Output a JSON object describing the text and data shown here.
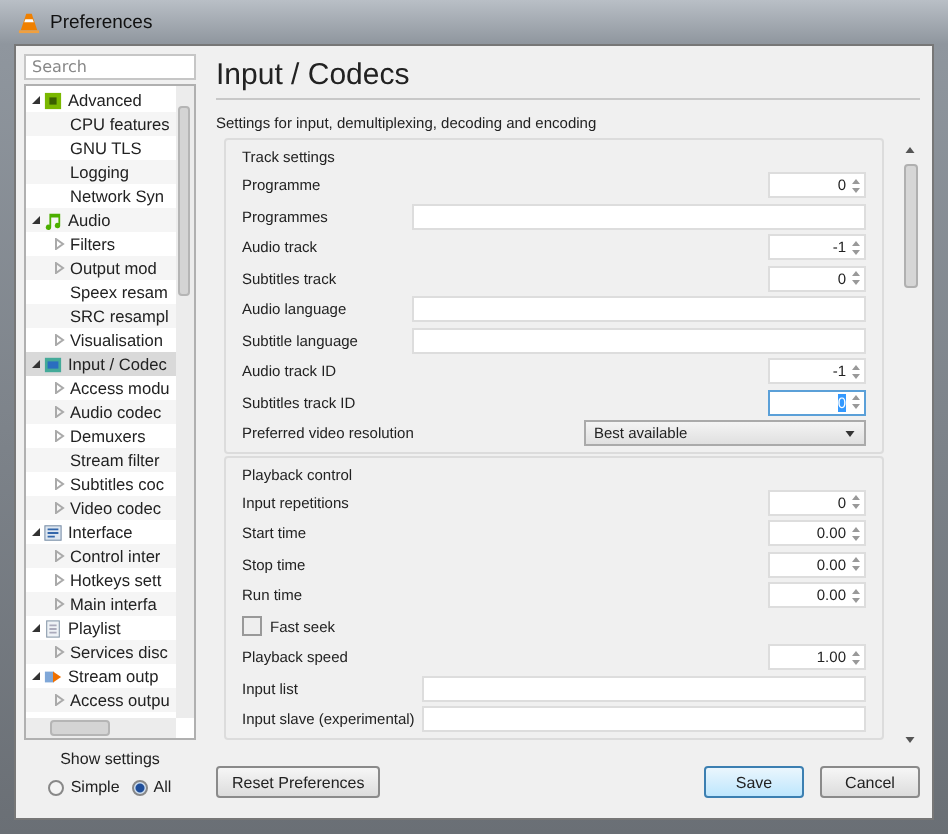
{
  "window": {
    "title": "Preferences"
  },
  "search": {
    "placeholder": "Search"
  },
  "tree": [
    {
      "label": "Advanced",
      "expanded": true,
      "selected": false,
      "children": [
        {
          "label": "CPU features",
          "expandable": false,
          "selected": false
        },
        {
          "label": "GNU TLS",
          "expandable": false,
          "selected": false
        },
        {
          "label": "Logging",
          "expandable": false,
          "selected": false
        },
        {
          "label": "Network Syn",
          "expandable": false,
          "selected": false
        }
      ]
    },
    {
      "label": "Audio",
      "expanded": true,
      "selected": false,
      "children": [
        {
          "label": "Filters",
          "expandable": true,
          "selected": false
        },
        {
          "label": "Output mod",
          "expandable": true,
          "selected": false
        },
        {
          "label": "Speex resam",
          "expandable": false,
          "selected": false
        },
        {
          "label": "SRC resampl",
          "expandable": false,
          "selected": false
        },
        {
          "label": "Visualisation",
          "expandable": true,
          "selected": false
        }
      ]
    },
    {
      "label": "Input / Codec",
      "expanded": true,
      "selected": true,
      "children": [
        {
          "label": "Access modu",
          "expandable": true,
          "selected": false
        },
        {
          "label": "Audio codec",
          "expandable": true,
          "selected": false
        },
        {
          "label": "Demuxers",
          "expandable": true,
          "selected": false
        },
        {
          "label": "Stream filter",
          "expandable": false,
          "selected": false
        },
        {
          "label": "Subtitles coc",
          "expandable": true,
          "selected": false
        },
        {
          "label": "Video codec",
          "expandable": true,
          "selected": false
        }
      ]
    },
    {
      "label": "Interface",
      "expanded": true,
      "selected": false,
      "children": [
        {
          "label": "Control inter",
          "expandable": true,
          "selected": false
        },
        {
          "label": "Hotkeys sett",
          "expandable": true,
          "selected": false
        },
        {
          "label": "Main interfa",
          "expandable": true,
          "selected": false
        }
      ]
    },
    {
      "label": "Playlist",
      "expanded": true,
      "selected": false,
      "children": [
        {
          "label": "Services disc",
          "expandable": true,
          "selected": false
        }
      ]
    },
    {
      "label": "Stream outp",
      "expanded": true,
      "selected": false,
      "children": [
        {
          "label": "Access outpu",
          "expandable": true,
          "selected": false
        }
      ]
    }
  ],
  "show_settings": {
    "label": "Show settings",
    "options": [
      {
        "label": "Simple",
        "selected": false
      },
      {
        "label": "All",
        "selected": true
      }
    ]
  },
  "page": {
    "title": "Input / Codecs",
    "description": "Settings for input, demultiplexing, decoding and encoding"
  },
  "sections": [
    {
      "title": "Track settings",
      "rows": [
        {
          "kind": "spin",
          "label": "Programme",
          "value": "0",
          "focused": false
        },
        {
          "kind": "text",
          "label": "Programmes"
        },
        {
          "kind": "spin",
          "label": "Audio track",
          "value": "-1",
          "focused": false
        },
        {
          "kind": "spin",
          "label": "Subtitles track",
          "value": "0",
          "focused": false
        },
        {
          "kind": "text",
          "label": "Audio language"
        },
        {
          "kind": "text",
          "label": "Subtitle language"
        },
        {
          "kind": "spin",
          "label": "Audio track ID",
          "value": "-1",
          "focused": false
        },
        {
          "kind": "spin",
          "label": "Subtitles track ID",
          "value": "0",
          "focused": true
        },
        {
          "kind": "combo",
          "label": "Preferred video resolution",
          "value": "Best available"
        }
      ]
    },
    {
      "title": "Playback control",
      "rows": [
        {
          "kind": "spin",
          "label": "Input repetitions",
          "value": "0",
          "focused": false
        },
        {
          "kind": "spin",
          "label": "Start time",
          "value": "0.00",
          "focused": false
        },
        {
          "kind": "spin",
          "label": "Stop time",
          "value": "0.00",
          "focused": false
        },
        {
          "kind": "spin",
          "label": "Run time",
          "value": "0.00",
          "focused": false
        },
        {
          "kind": "checkbox",
          "label": "Fast seek",
          "checked": false
        },
        {
          "kind": "spin",
          "label": "Playback speed",
          "value": "1.00",
          "focused": false
        },
        {
          "kind": "text",
          "label": "Input list"
        },
        {
          "kind": "text",
          "label": "Input slave (experimental)"
        }
      ]
    }
  ],
  "buttons": [
    {
      "label": "Reset Preferences",
      "default": false
    },
    {
      "label": "Save",
      "default": true
    },
    {
      "label": "Cancel",
      "default": false
    }
  ]
}
